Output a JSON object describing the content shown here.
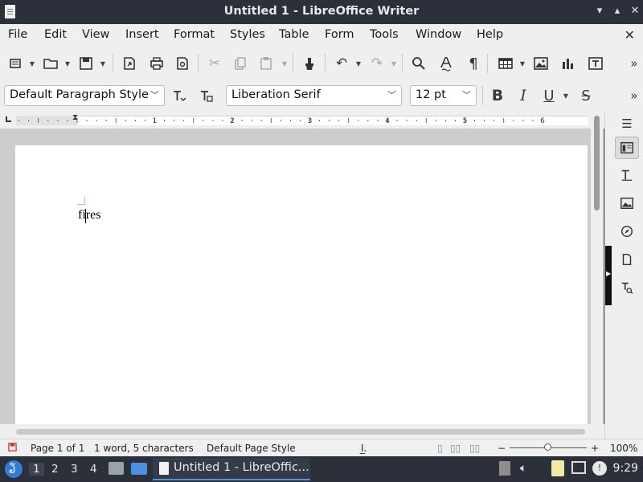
{
  "window": {
    "title": "Untitled 1 - LibreOffice Writer"
  },
  "menu": {
    "items": [
      "File",
      "Edit",
      "View",
      "Insert",
      "Format",
      "Styles",
      "Table",
      "Form",
      "Tools",
      "Window",
      "Help"
    ]
  },
  "formatting": {
    "paragraph_style": "Default Paragraph Style",
    "font_name": "Liberation Serif",
    "font_size": "12 pt"
  },
  "document": {
    "text": "fires"
  },
  "status": {
    "page": "Page 1 of 1",
    "words": "1 word, 5 characters",
    "page_style": "Default Page Style",
    "zoom": "100%",
    "zoom_minus": "−",
    "zoom_plus": "+"
  },
  "ruler": {
    "numbers": [
      "1",
      "2",
      "3",
      "4",
      "5",
      "6"
    ]
  },
  "taskbar": {
    "workspaces": [
      "1",
      "2",
      "3",
      "4"
    ],
    "task_label": "Untitled 1 - LibreOffic...",
    "clock": "9:29"
  },
  "colors": {
    "accent": "#5294e2",
    "titlebar": "#2b303b",
    "chrome": "#efefef"
  }
}
